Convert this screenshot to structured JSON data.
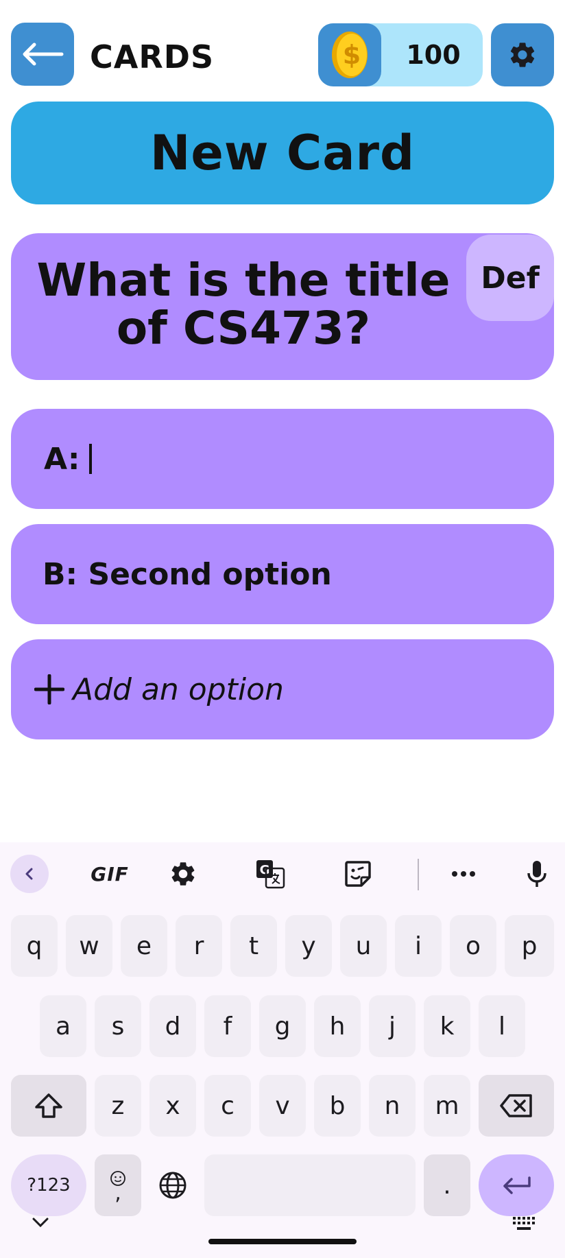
{
  "header": {
    "title": "CARDS",
    "coins": "100",
    "back_icon": "arrow-left-icon",
    "coin_icon": "gold-coin-icon",
    "settings_icon": "gear-icon"
  },
  "new_card_label": "New Card",
  "question": {
    "text": "What is the title of CS473?",
    "def_label": "Def"
  },
  "options": {
    "a_label": "A:",
    "a_value": "",
    "b_label": "B: Second option",
    "add_label": "Add an option"
  },
  "colors": {
    "header_button": "#3f8fd1",
    "coin_bg": "#ade5fb",
    "new_card": "#2ea9e3",
    "card_purple": "#b08cff",
    "def_button": "#cdb6ff"
  },
  "keyboard": {
    "toolbar": {
      "gif_label": "GIF",
      "icons": [
        "chevron-left-icon",
        "gear-icon",
        "translate-icon",
        "sticker-icon",
        "more-icon",
        "microphone-icon"
      ]
    },
    "row1": [
      "q",
      "w",
      "e",
      "r",
      "t",
      "y",
      "u",
      "i",
      "o",
      "p"
    ],
    "row2": [
      "a",
      "s",
      "d",
      "f",
      "g",
      "h",
      "j",
      "k",
      "l"
    ],
    "row3": [
      "z",
      "x",
      "c",
      "v",
      "b",
      "n",
      "m"
    ],
    "symbols_label": "?123",
    "emoji_comma_label": ",",
    "period_label": "."
  }
}
